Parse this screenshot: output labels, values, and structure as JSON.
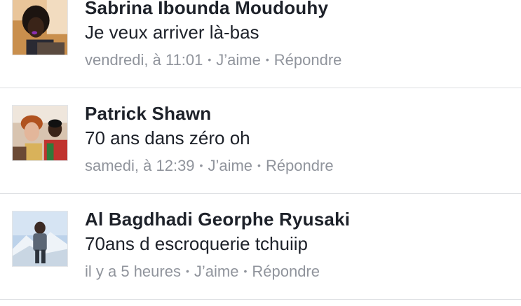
{
  "comments": [
    {
      "author": "Sabrina Ibounda Moudouhy",
      "text": "Je veux arriver là-bas",
      "timestamp": "vendredi, à 11:01",
      "like_label": "J’aime",
      "reply_label": "Répondre",
      "separator": "•"
    },
    {
      "author": "Patrick Shawn",
      "text": "70 ans dans zéro oh",
      "timestamp": "samedi, à 12:39",
      "like_label": "J’aime",
      "reply_label": "Répondre",
      "separator": "•"
    },
    {
      "author": "Al Bagdhadi Georphe Ryusaki",
      "text": "70ans d escroquerie tchuiip",
      "timestamp": "il y a 5 heures",
      "like_label": "J’aime",
      "reply_label": "Répondre",
      "separator": "•"
    }
  ],
  "colors": {
    "name": "#1d2129",
    "text": "#1d2129",
    "meta": "#90949c",
    "divider": "#dddfe2",
    "background": "#ffffff"
  }
}
